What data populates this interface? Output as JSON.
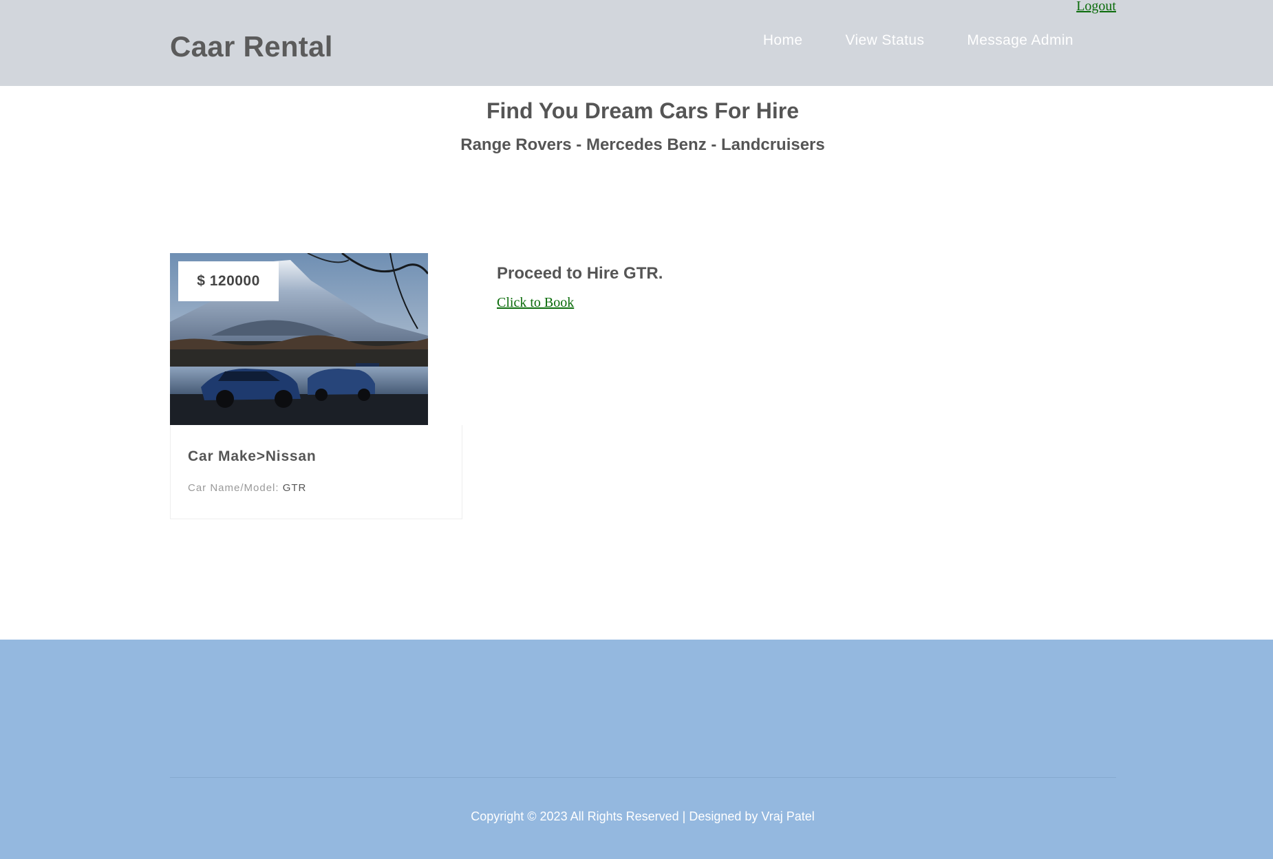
{
  "header": {
    "logout_label": "Logout",
    "brand": "Caar Rental",
    "nav": [
      {
        "label": "Home"
      },
      {
        "label": "View Status"
      },
      {
        "label": "Message Admin"
      }
    ]
  },
  "hero": {
    "title": "Find You Dream Cars For Hire",
    "subtitle": "Range Rovers - Mercedes Benz - Landcruisers"
  },
  "car": {
    "price": "$ 120000",
    "make": "Car Make>Nissan",
    "model_label": "Car Name/Model:",
    "model_value": "GTR"
  },
  "hire": {
    "title": "Proceed to Hire GTR.",
    "book_label": "Click to Book"
  },
  "footer": {
    "copyright": "Copyright © 2023 All Rights Reserved | Designed by Vraj Patel"
  },
  "colors": {
    "header_bg": "#d2d6dc",
    "footer_bg": "#94b8df",
    "link_green": "#0a6b0a"
  }
}
